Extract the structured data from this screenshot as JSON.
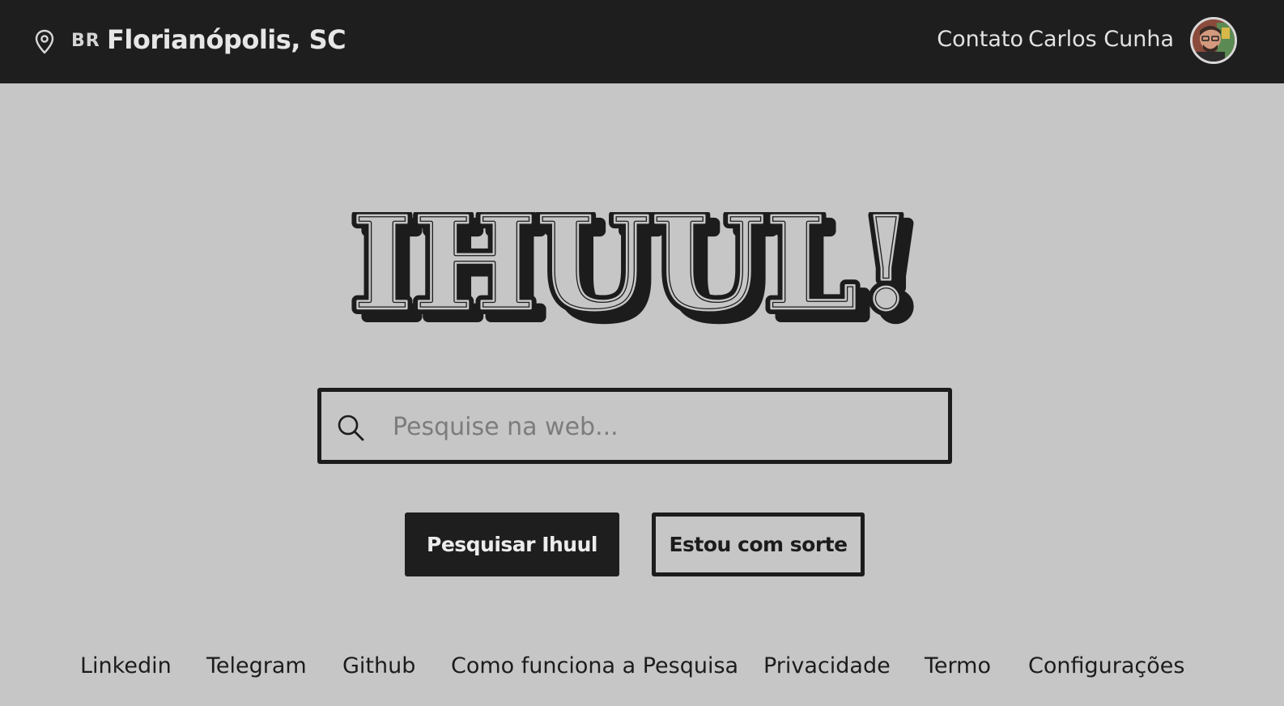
{
  "header": {
    "country_code": "BR",
    "city": "Florianópolis, SC",
    "nav": {
      "contact_label": "Contato",
      "user_name": "Carlos Cunha"
    }
  },
  "main": {
    "logo_text": "IHUUL!",
    "search": {
      "value": "",
      "placeholder": "Pesquise na web..."
    },
    "buttons": {
      "search_label": "Pesquisar Ihuul",
      "lucky_label": "Estou com sorte"
    }
  },
  "footer": {
    "links": [
      "Linkedin",
      "Telegram",
      "Github",
      "Como funciona a Pesquisa",
      "Privacidade",
      "Termo",
      "Configurações"
    ]
  },
  "colors": {
    "background": "#c6c6c6",
    "header_bg": "#1e1e1e",
    "ink": "#1c1c1c"
  },
  "icons": {
    "location": "map-pin-icon",
    "search": "search-icon",
    "avatar": "user-avatar"
  }
}
